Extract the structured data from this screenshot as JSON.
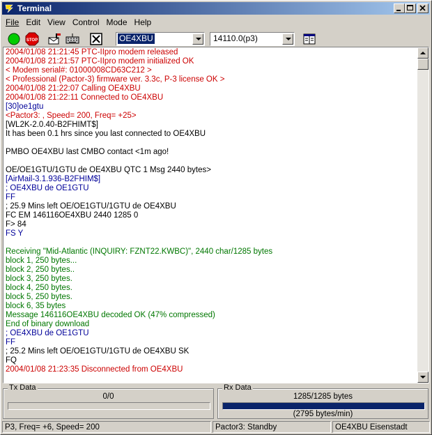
{
  "window": {
    "title": "Terminal"
  },
  "menu": [
    "File",
    "Edit",
    "View",
    "Control",
    "Mode",
    "Help"
  ],
  "toolbar": {
    "stop_label": "STOP",
    "callsign": "OE4XBU",
    "frequency": "14110.0(p3)"
  },
  "colors": {
    "red": "#cc0000",
    "blue": "#000099",
    "green": "#007700",
    "black": "#000000"
  },
  "terminal": {
    "lines": [
      {
        "text": "2004/01/08 21:21:45 PTC-IIpro modem released",
        "color": "red"
      },
      {
        "text": "2004/01/08 21:21:57 PTC-IIpro modem initialized OK",
        "color": "red"
      },
      {
        "text": "< Modem serial#: 01000008CD63C212 >",
        "color": "red"
      },
      {
        "text": "< Professional (Pactor-3) firmware ver. 3.3c, P-3 license OK >",
        "color": "red"
      },
      {
        "text": "2004/01/08 21:22:07 Calling OE4XBU",
        "color": "red"
      },
      {
        "text": "2004/01/08 21:22:11 Connected to OE4XBU",
        "color": "red"
      },
      {
        "text": "[30]oe1gtu",
        "color": "blue"
      },
      {
        "text": "<Pactor3: , Speed= 200, Freq= +25>",
        "color": "red"
      },
      {
        "text": "[WL2K-2.0.40-B2FHIMT$]",
        "color": "black"
      },
      {
        "text": "It has been 0.1 hrs since you last connected to OE4XBU",
        "color": "black"
      },
      {
        "text": "",
        "color": "black"
      },
      {
        "text": "PMBO OE4XBU last CMBO contact <1m ago!",
        "color": "black"
      },
      {
        "text": "",
        "color": "black"
      },
      {
        "text": "OE/OE1GTU/1GTU de OE4XBU QTC 1 Msg 2440 bytes>",
        "color": "black"
      },
      {
        "text": "[AirMail-3.1.936-B2FHIM$]",
        "color": "blue"
      },
      {
        "text": "; OE4XBU de OE1GTU",
        "color": "blue"
      },
      {
        "text": "FF",
        "color": "blue"
      },
      {
        "text": "; 25.9 Mins left OE/OE1GTU/1GTU de OE4XBU",
        "color": "black"
      },
      {
        "text": "FC EM 146116OE4XBU 2440 1285 0",
        "color": "black"
      },
      {
        "text": "F> 84",
        "color": "black"
      },
      {
        "text": "FS Y",
        "color": "blue"
      },
      {
        "text": "",
        "color": "black"
      },
      {
        "text": "Receiving \"Mid-Atlantic (INQUIRY: FZNT22.KWBC)\", 2440 char/1285 bytes",
        "color": "green"
      },
      {
        "text": "block 1, 250 bytes...",
        "color": "green"
      },
      {
        "text": "block 2, 250 bytes..",
        "color": "green"
      },
      {
        "text": "block 3, 250 bytes.",
        "color": "green"
      },
      {
        "text": "block 4, 250 bytes.",
        "color": "green"
      },
      {
        "text": "block 5, 250 bytes.",
        "color": "green"
      },
      {
        "text": "block 6, 35 bytes",
        "color": "green"
      },
      {
        "text": "Message 146116OE4XBU decoded OK (47% compressed)",
        "color": "green"
      },
      {
        "text": "End of binary download",
        "color": "green"
      },
      {
        "text": "; OE4XBU de OE1GTU",
        "color": "blue"
      },
      {
        "text": "FF",
        "color": "blue"
      },
      {
        "text": "; 25.2 Mins left OE/OE1GTU/1GTU de OE4XBU SK",
        "color": "black"
      },
      {
        "text": "FQ",
        "color": "black"
      },
      {
        "text": "2004/01/08 21:23:35 Disconnected from OE4XBU",
        "color": "red"
      }
    ]
  },
  "tx": {
    "label": "Tx Data",
    "value": "0/0",
    "progress": 0
  },
  "rx": {
    "label": "Rx Data",
    "value": "1285/1285 bytes",
    "rate": "(2795 bytes/min)",
    "progress": 1.0
  },
  "status": {
    "left": "P3, Freq= +6, Speed= 200",
    "middle": "Pactor3: Standby",
    "right": "OE4XBU Eisenstadt"
  }
}
